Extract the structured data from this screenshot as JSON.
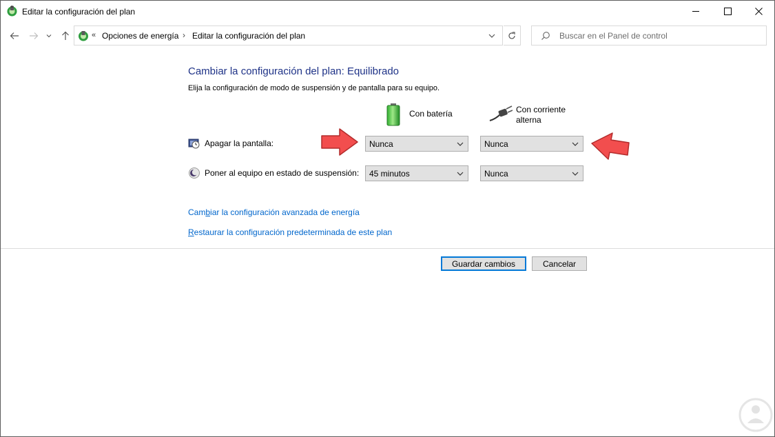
{
  "window": {
    "title": "Editar la configuración del plan",
    "minimize_icon": "minimize-icon",
    "maximize_icon": "maximize-icon",
    "close_icon": "close-icon"
  },
  "nav": {
    "back_icon": "back-arrow-icon",
    "forward_icon": "forward-arrow-icon",
    "recent_icon": "chevron-down-icon",
    "up_icon": "up-arrow-icon"
  },
  "address": {
    "overflow": "«",
    "crumbs": [
      "Opciones de energía",
      "Editar la configuración del plan"
    ],
    "separator": "›"
  },
  "search": {
    "placeholder": "Buscar en el Panel de control"
  },
  "main": {
    "heading": "Cambiar la configuración del plan: Equilibrado",
    "subtext": "Elija la configuración de modo de suspensión y de pantalla para su equipo.",
    "columns": {
      "battery": "Con batería",
      "ac_line1": "Con corriente",
      "ac_line2": "alterna"
    },
    "rows": [
      {
        "label": "Apagar la pantalla:",
        "battery_value": "Nunca",
        "ac_value": "Nunca"
      },
      {
        "label": "Poner al equipo en estado de suspensión:",
        "battery_value": "45 minutos",
        "ac_value": "Nunca"
      }
    ],
    "links": {
      "advanced_prefix": "Cam",
      "advanced_ul": "b",
      "advanced_rest": "iar la configuración avanzada de energía",
      "restore_ul": "R",
      "restore_rest": "estaurar la configuración predeterminada de este plan"
    }
  },
  "buttons": {
    "save": "Guardar cambios",
    "cancel": "Cancelar"
  },
  "colors": {
    "heading": "#1e3287",
    "link": "#0066cc",
    "annotation_arrow": "#f24e4e"
  }
}
